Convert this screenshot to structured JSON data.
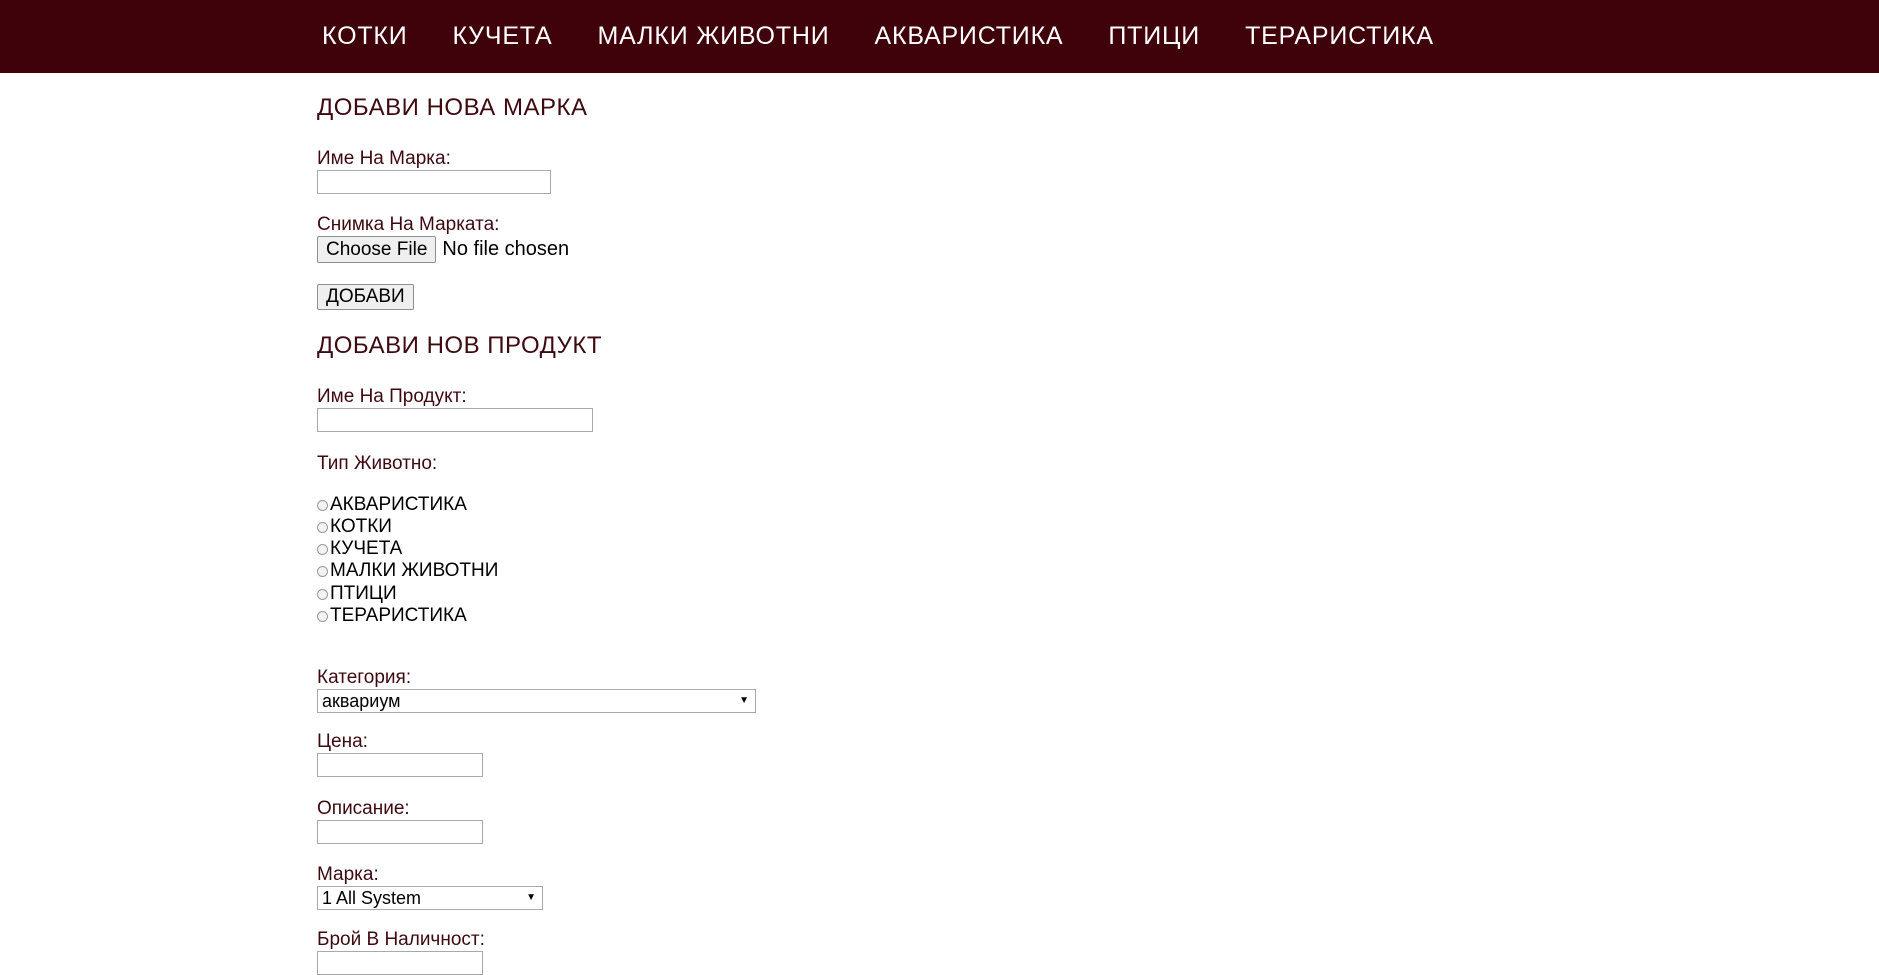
{
  "nav": {
    "items": [
      "КОТКИ",
      "КУЧЕТА",
      "МАЛКИ ЖИВОТНИ",
      "АКВАРИСТИКА",
      "ПТИЦИ",
      "ТЕРАРИСТИКА"
    ]
  },
  "brand_form": {
    "title": "ДОБАВИ НОВА МАРКА",
    "name_label": "Име На Марка:",
    "name_value": "",
    "image_label": "Снимка На Марката:",
    "file_button": "Choose File",
    "file_status": "No file chosen",
    "submit_label": "ДОБАВИ"
  },
  "product_form": {
    "title": "ДОБАВИ НОВ ПРОДУКТ",
    "name_label": "Име На Продукт:",
    "name_value": "",
    "animal_type_label": "Тип Животно:",
    "animal_types": [
      "АКВАРИСТИКА",
      "КОТКИ",
      "КУЧЕТА",
      "МАЛКИ ЖИВОТНИ",
      "ПТИЦИ",
      "ТЕРАРИСТИКА"
    ],
    "category_label": "Категория:",
    "category_value": "аквариум",
    "price_label": "Цена:",
    "price_value": "",
    "description_label": "Описание:",
    "description_value": "",
    "brand_label": "Марка:",
    "brand_value": "1 All System",
    "stock_label": "Брой В Наличност:",
    "stock_value": ""
  },
  "colors": {
    "nav_background": "#3f020b",
    "label_text": "#3d0a10"
  },
  "icons": {
    "select_arrow": "dropdown-arrow-icon"
  }
}
